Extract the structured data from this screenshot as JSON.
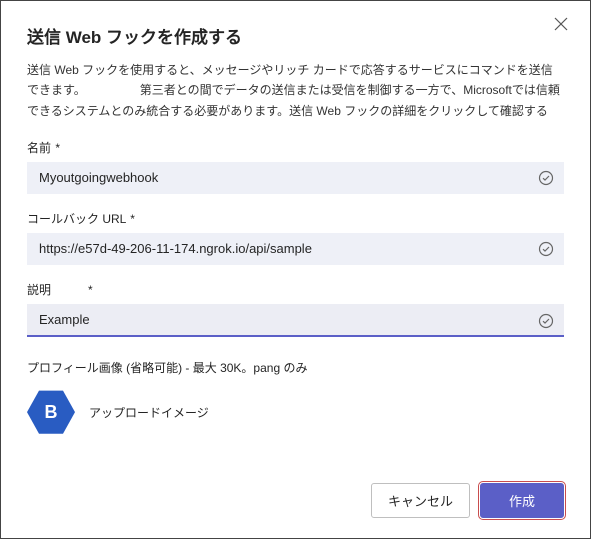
{
  "title": "送信 Web フックを作成する",
  "description": "送信 Web フックを使用すると、メッセージやリッチ カードで応答するサービスにコマンドを送信できます。　　　　　第三者との間でデータの送信または受信を制御する一方で、Microsoftでは信頼できるシステムとのみ統合する必要があります。送信 Web フックの詳細をクリックして確認する",
  "fields": {
    "name": {
      "label": "名前",
      "required": "*",
      "value": "Myoutgoingwebhook"
    },
    "callback": {
      "label": "コールバック URL",
      "required": "*",
      "value": "https://e57d-49-206-11-174.ngrok.io/api/sample"
    },
    "desc": {
      "label": "説明",
      "required": "*",
      "value": "Example"
    }
  },
  "profile": {
    "label": "プロフィール画像 (省略可能) - 最大 30K。pang のみ",
    "initial": "B",
    "upload": "アップロードイメージ"
  },
  "buttons": {
    "cancel": "キャンセル",
    "create": "作成"
  }
}
